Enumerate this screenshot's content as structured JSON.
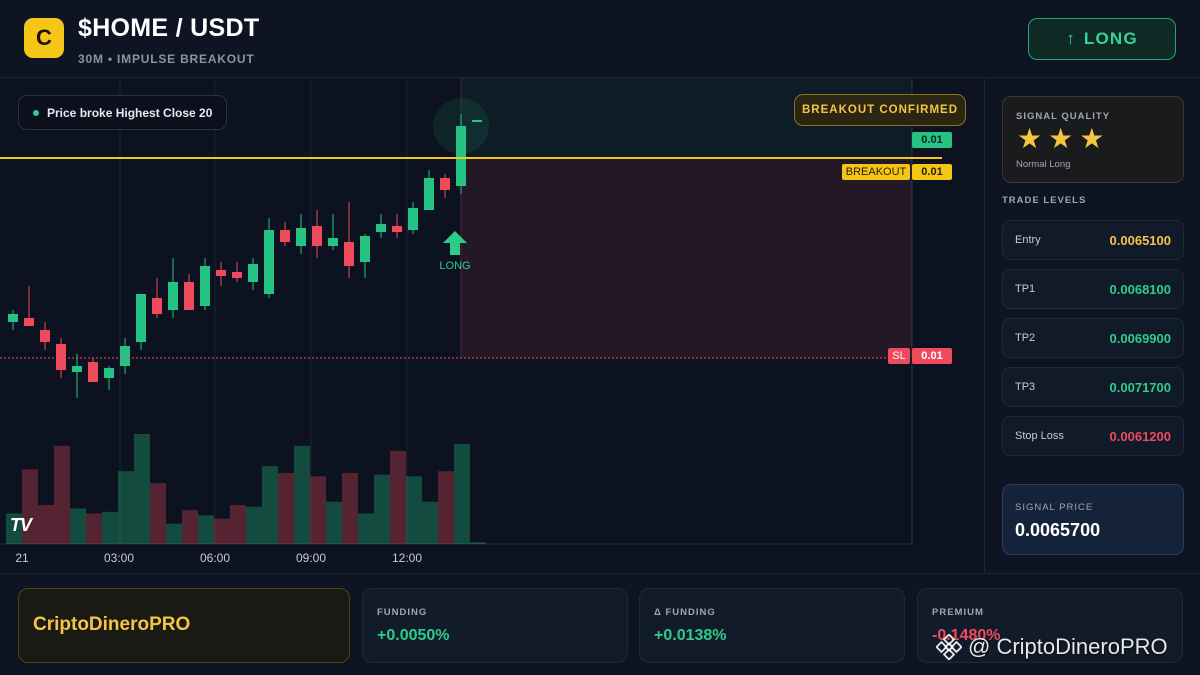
{
  "header": {
    "logo_letter": "C",
    "title": "$HOME / USDT",
    "subtitle": "30M • IMPULSE BREAKOUT",
    "long_button": {
      "arrow": "↑",
      "label": "LONG"
    }
  },
  "chart": {
    "callout": "Price broke Highest Close 20",
    "confirmed_badge": "BREAKOUT CONFIRMED",
    "last_price_tag": "0.01",
    "breakout_label": "BREAKOUT",
    "breakout_value": "0.01",
    "sl_label": "SL",
    "sl_value": "0.01",
    "long_marker_label": "LONG",
    "time_labels": [
      "21",
      "03:00",
      "06:00",
      "09:00",
      "12:00"
    ],
    "colors": {
      "up": "#26c484",
      "down": "#ef4b5c",
      "breakout": "#f5c518",
      "sl": "#ef4b5c"
    }
  },
  "chart_data": {
    "type": "candlestick",
    "candles": [
      {
        "o": 0.00648,
        "h": 0.00654,
        "l": 0.00644,
        "c": 0.00652
      },
      {
        "o": 0.0065,
        "h": 0.00666,
        "l": 0.00646,
        "c": 0.00646
      },
      {
        "o": 0.00644,
        "h": 0.00648,
        "l": 0.00634,
        "c": 0.00638
      },
      {
        "o": 0.00637,
        "h": 0.0064,
        "l": 0.0062,
        "c": 0.00624
      },
      {
        "o": 0.00623,
        "h": 0.00632,
        "l": 0.0061,
        "c": 0.00626
      },
      {
        "o": 0.00628,
        "h": 0.0063,
        "l": 0.00618,
        "c": 0.00618
      },
      {
        "o": 0.0062,
        "h": 0.00626,
        "l": 0.00614,
        "c": 0.00625
      },
      {
        "o": 0.00626,
        "h": 0.0064,
        "l": 0.00622,
        "c": 0.00636
      },
      {
        "o": 0.00638,
        "h": 0.00662,
        "l": 0.00634,
        "c": 0.00662
      },
      {
        "o": 0.0066,
        "h": 0.0067,
        "l": 0.0065,
        "c": 0.00652
      },
      {
        "o": 0.00654,
        "h": 0.0068,
        "l": 0.0065,
        "c": 0.00668
      },
      {
        "o": 0.00668,
        "h": 0.00672,
        "l": 0.00654,
        "c": 0.00654
      },
      {
        "o": 0.00656,
        "h": 0.0068,
        "l": 0.00654,
        "c": 0.00676
      },
      {
        "o": 0.00674,
        "h": 0.00678,
        "l": 0.00666,
        "c": 0.00671
      },
      {
        "o": 0.00673,
        "h": 0.00678,
        "l": 0.00668,
        "c": 0.0067
      },
      {
        "o": 0.00668,
        "h": 0.0068,
        "l": 0.00664,
        "c": 0.00677
      },
      {
        "o": 0.00662,
        "h": 0.007,
        "l": 0.0066,
        "c": 0.00694
      },
      {
        "o": 0.00694,
        "h": 0.00698,
        "l": 0.00686,
        "c": 0.00688
      },
      {
        "o": 0.00686,
        "h": 0.00702,
        "l": 0.00682,
        "c": 0.00695
      },
      {
        "o": 0.00696,
        "h": 0.00704,
        "l": 0.0068,
        "c": 0.00686
      },
      {
        "o": 0.00686,
        "h": 0.00702,
        "l": 0.00684,
        "c": 0.0069
      },
      {
        "o": 0.00688,
        "h": 0.00708,
        "l": 0.0067,
        "c": 0.00676
      },
      {
        "o": 0.00678,
        "h": 0.00692,
        "l": 0.0067,
        "c": 0.00691
      },
      {
        "o": 0.00693,
        "h": 0.00702,
        "l": 0.0069,
        "c": 0.00697
      },
      {
        "o": 0.00696,
        "h": 0.00702,
        "l": 0.0069,
        "c": 0.00693
      },
      {
        "o": 0.00694,
        "h": 0.00708,
        "l": 0.00692,
        "c": 0.00705
      },
      {
        "o": 0.00704,
        "h": 0.00724,
        "l": 0.00704,
        "c": 0.0072
      },
      {
        "o": 0.0072,
        "h": 0.00722,
        "l": 0.0071,
        "c": 0.00714
      },
      {
        "o": 0.00716,
        "h": 0.00752,
        "l": 0.00712,
        "c": 0.00746
      },
      {
        "o": 0.00748,
        "h": 0.00749,
        "l": 0.00748,
        "c": 0.00749
      }
    ],
    "volumes": [
      0.18,
      0.44,
      0.23,
      0.58,
      0.21,
      0.18,
      0.19,
      0.43,
      0.65,
      0.36,
      0.12,
      0.2,
      0.17,
      0.15,
      0.23,
      0.22,
      0.46,
      0.42,
      0.58,
      0.4,
      0.25,
      0.42,
      0.18,
      0.41,
      0.55,
      0.4,
      0.25,
      0.43,
      0.59,
      0.01
    ],
    "price_range": [
      0.006,
      0.0076
    ],
    "breakout_level": 0.0073,
    "stop_loss_level": 0.0063,
    "grid": true
  },
  "signal_quality": {
    "title": "SIGNAL QUALITY",
    "stars": 3,
    "star_glyph": "★",
    "subtitle": "Normal Long"
  },
  "trade_levels": {
    "title": "TRADE LEVELS",
    "rows": [
      {
        "label": "Entry",
        "value": "0.0065100",
        "color": "#f5c542"
      },
      {
        "label": "TP1",
        "value": "0.0068100",
        "color": "#2ecc8a"
      },
      {
        "label": "TP2",
        "value": "0.0069900",
        "color": "#2ecc8a"
      },
      {
        "label": "TP3",
        "value": "0.0071700",
        "color": "#2ecc8a"
      },
      {
        "label": "Stop Loss",
        "value": "0.0061200",
        "color": "#ef4b5c"
      }
    ]
  },
  "signal_price": {
    "title": "SIGNAL PRICE",
    "value": "0.0065700"
  },
  "footer": {
    "brand": "CriptoDineroPRO",
    "funding": {
      "title": "FUNDING",
      "value": "+0.0050%",
      "color": "#2ecc8a"
    },
    "delta_funding": {
      "title": "Δ FUNDING",
      "value": "+0.0138%",
      "color": "#2ecc8a"
    },
    "premium": {
      "title": "PREMIUM",
      "value": "-0.1480%",
      "color": "#ef4b5c"
    }
  },
  "watermark": {
    "text": "@ CriptoDineroPRO",
    "icon": "binance-icon"
  }
}
